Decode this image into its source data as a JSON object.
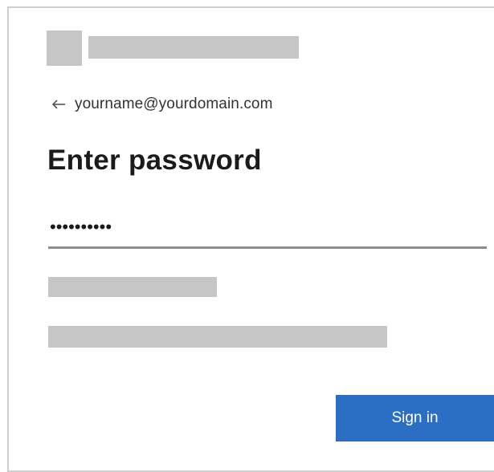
{
  "account": {
    "identity": "yourname@yourdomain.com",
    "back_icon": "arrow-left-icon"
  },
  "form": {
    "title": "Enter password",
    "password_value": "••••••••••",
    "signin_label": "Sign in"
  },
  "colors": {
    "accent": "#2c6ec4",
    "placeholder_block": "#c6c6c6",
    "border": "#cfcfcf"
  }
}
